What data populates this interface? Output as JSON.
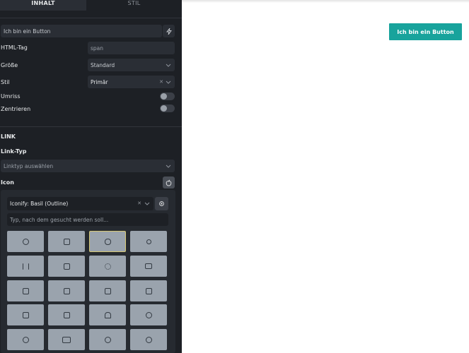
{
  "tabs": {
    "inhalt": "INHALT",
    "stil": "STIL"
  },
  "fields": {
    "button_text": "Ich bin ein Button",
    "html_tag_label": "HTML-Tag",
    "html_tag_value": "span",
    "size_label": "Größe",
    "size_value": "Standard",
    "style_label": "Stil",
    "style_value": "Primär",
    "outline_label": "Umriss",
    "center_label": "Zentrieren"
  },
  "link": {
    "section_title": "LINK",
    "type_label": "Link-Typ",
    "type_placeholder": "Linktyp auswählen"
  },
  "icon": {
    "label": "Icon",
    "library_value": "Iconify: Basil (Outline)",
    "search_placeholder": "Typ, nach dem gesucht werden soll...",
    "tiles": [
      "alarm-icon",
      "mail-box-icon",
      "apple-icon",
      "zoom-in-icon",
      "pause-icon",
      "linkedin-icon",
      "settings-gear-icon",
      "camera-icon",
      "app-square-icon",
      "app-square-2-icon",
      "app-square-3-icon",
      "app-square-4-icon",
      "app-square-5-icon",
      "app-square-6-icon",
      "android-icon",
      "fan-icon",
      "fan-2-icon",
      "behance-icon",
      "chrome-icon",
      "dribbble-icon"
    ]
  },
  "preview": {
    "button_label": "Ich bin ein Button"
  },
  "colors": {
    "accent": "#18a39c",
    "panel": "#1d2025",
    "field": "#2a2e35"
  }
}
